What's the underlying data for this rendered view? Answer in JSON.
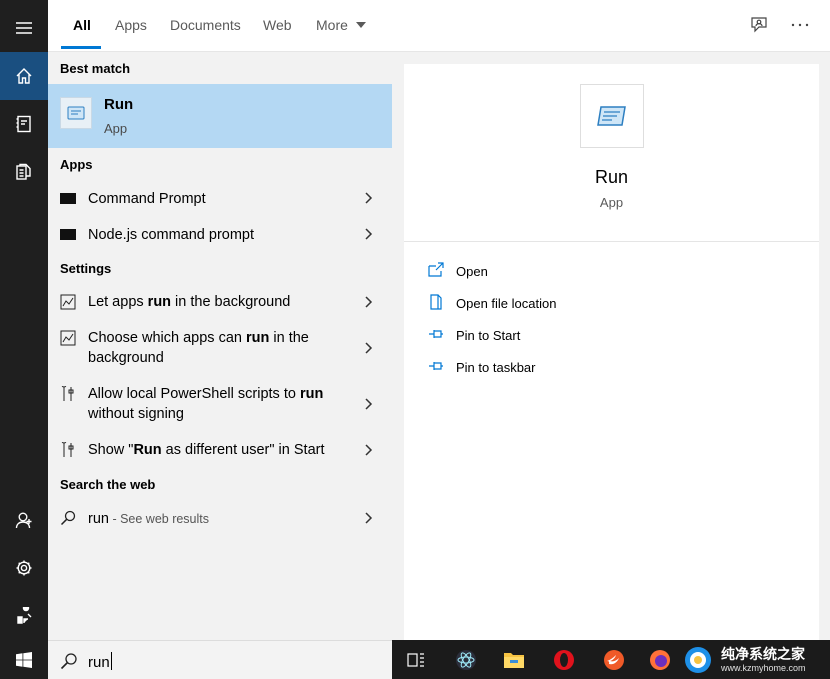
{
  "tabs": [
    {
      "label": "All"
    },
    {
      "label": "Apps"
    },
    {
      "label": "Documents"
    },
    {
      "label": "Web"
    },
    {
      "label": "More"
    }
  ],
  "rail_icons": [
    "hamburger-icon",
    "home-icon",
    "notebook-icon",
    "documents-icon",
    "user-icon",
    "settings-icon",
    "feedback-icon"
  ],
  "results": {
    "best_match_title": "Best match",
    "best": {
      "name": "Run",
      "type": "App"
    },
    "apps_title": "Apps",
    "apps": [
      {
        "label": "Command Prompt"
      },
      {
        "label": "Node.js command prompt"
      }
    ],
    "settings_title": "Settings",
    "settings": [
      {
        "pre": "Let apps ",
        "bold": "run",
        "post": " in the background"
      },
      {
        "pre": "Choose which apps can ",
        "bold": "run",
        "post": " in the background"
      },
      {
        "pre": "Allow local PowerShell scripts to ",
        "bold": "run",
        "post": " without signing"
      },
      {
        "pre": "Show \"",
        "bold": "Run",
        "post": " as different user\" in Start"
      }
    ],
    "web_title": "Search the web",
    "web": {
      "query": "run",
      "suffix": " - See web results"
    }
  },
  "preview": {
    "name": "Run",
    "type": "App",
    "actions": [
      {
        "label": "Open"
      },
      {
        "label": "Open file location"
      },
      {
        "label": "Pin to Start"
      },
      {
        "label": "Pin to taskbar"
      }
    ]
  },
  "search": {
    "value": "run"
  },
  "watermark": {
    "text": "纯净系统之家",
    "url": "www.kzmyhome.com"
  },
  "colors": {
    "accent": "#0078d4",
    "selected": "#b4d8f3",
    "rail": "#1f1f1f",
    "rail_active": "#1a4f80"
  }
}
